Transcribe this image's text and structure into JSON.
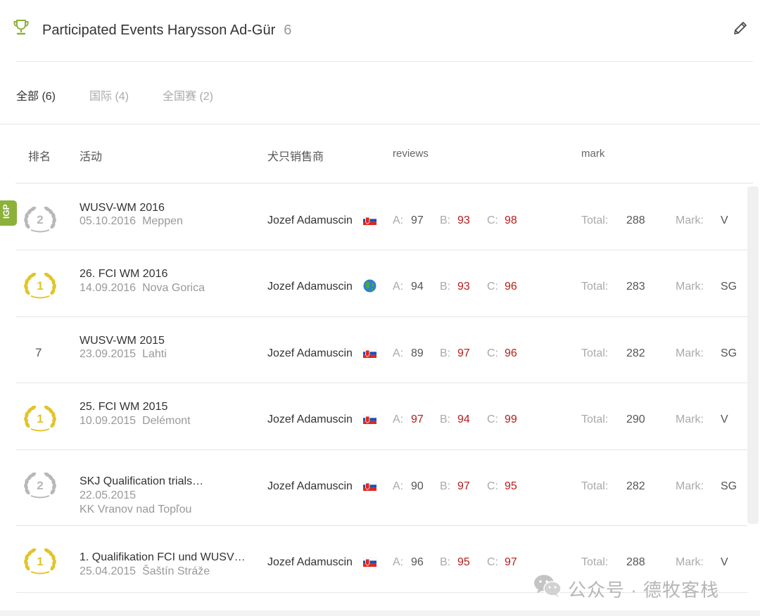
{
  "header": {
    "title": "Participated Events Harysson Ad-Gür",
    "count": "6"
  },
  "tabs": [
    {
      "label": "全部 (6)",
      "active": true
    },
    {
      "label": "国际 (4)",
      "active": false
    },
    {
      "label": "全国赛 (2)",
      "active": false
    }
  ],
  "columns": {
    "rank": "排名",
    "event": "活动",
    "breeder": "犬只销售商",
    "reviews": "reviews",
    "mark": "mark"
  },
  "labels": {
    "a": "A:",
    "b": "B:",
    "c": "C:",
    "total": "Total:",
    "mark": "Mark:"
  },
  "side_tab": "IGP",
  "rows": [
    {
      "rank": "2",
      "medal": "silver",
      "title": "WUSV-WM 2016",
      "date": "05.10.2016",
      "location": "Meppen",
      "breeder": "Jozef Adamuscin",
      "flag": "sk-flag-icon",
      "a": "97",
      "b": "93",
      "c": "98",
      "total": "288",
      "mark": "V",
      "a_hi": false,
      "b_hi": true,
      "c_hi": true
    },
    {
      "rank": "1",
      "medal": "gold",
      "title": "26. FCI WM 2016",
      "date": "14.09.2016",
      "location": "Nova Gorica",
      "breeder": "Jozef Adamuscin",
      "flag": "globe-icon",
      "a": "94",
      "b": "93",
      "c": "96",
      "total": "283",
      "mark": "SG",
      "a_hi": false,
      "b_hi": true,
      "c_hi": true
    },
    {
      "rank": "7",
      "medal": "none",
      "title": "WUSV-WM 2015",
      "date": "23.09.2015",
      "location": "Lahti",
      "breeder": "Jozef Adamuscin",
      "flag": "sk-flag-icon",
      "a": "89",
      "b": "97",
      "c": "96",
      "total": "282",
      "mark": "SG",
      "a_hi": false,
      "b_hi": true,
      "c_hi": true
    },
    {
      "rank": "1",
      "medal": "gold",
      "title": "25. FCI WM 2015",
      "date": "10.09.2015",
      "location": "Delémont",
      "breeder": "Jozef Adamuscin",
      "flag": "sk-flag-icon",
      "a": "97",
      "b": "94",
      "c": "99",
      "total": "290",
      "mark": "V",
      "a_hi": true,
      "b_hi": true,
      "c_hi": true
    },
    {
      "rank": "2",
      "medal": "silver",
      "title": "SKJ Qualification trials…",
      "date": "22.05.2015",
      "location": "KK Vranov nad Topľou",
      "breeder": "Jozef Adamuscin",
      "flag": "sk-flag-icon",
      "a": "90",
      "b": "97",
      "c": "95",
      "total": "282",
      "mark": "SG",
      "a_hi": false,
      "b_hi": true,
      "c_hi": true
    },
    {
      "rank": "1",
      "medal": "gold",
      "title": "1. Qualifikation FCI und WUSV…",
      "date": "25.04.2015",
      "location": "Šaštín Stráže",
      "breeder": "Jozef Adamuscin",
      "flag": "sk-flag-icon",
      "a": "96",
      "b": "95",
      "c": "97",
      "total": "288",
      "mark": "V",
      "a_hi": false,
      "b_hi": true,
      "c_hi": true
    }
  ],
  "watermark": "公众号 · 德牧客栈",
  "colors": {
    "accent": "#8bb13a",
    "highlight": "#b71c1c",
    "gold": "#e2c42a",
    "silver": "#b8b8b8"
  }
}
